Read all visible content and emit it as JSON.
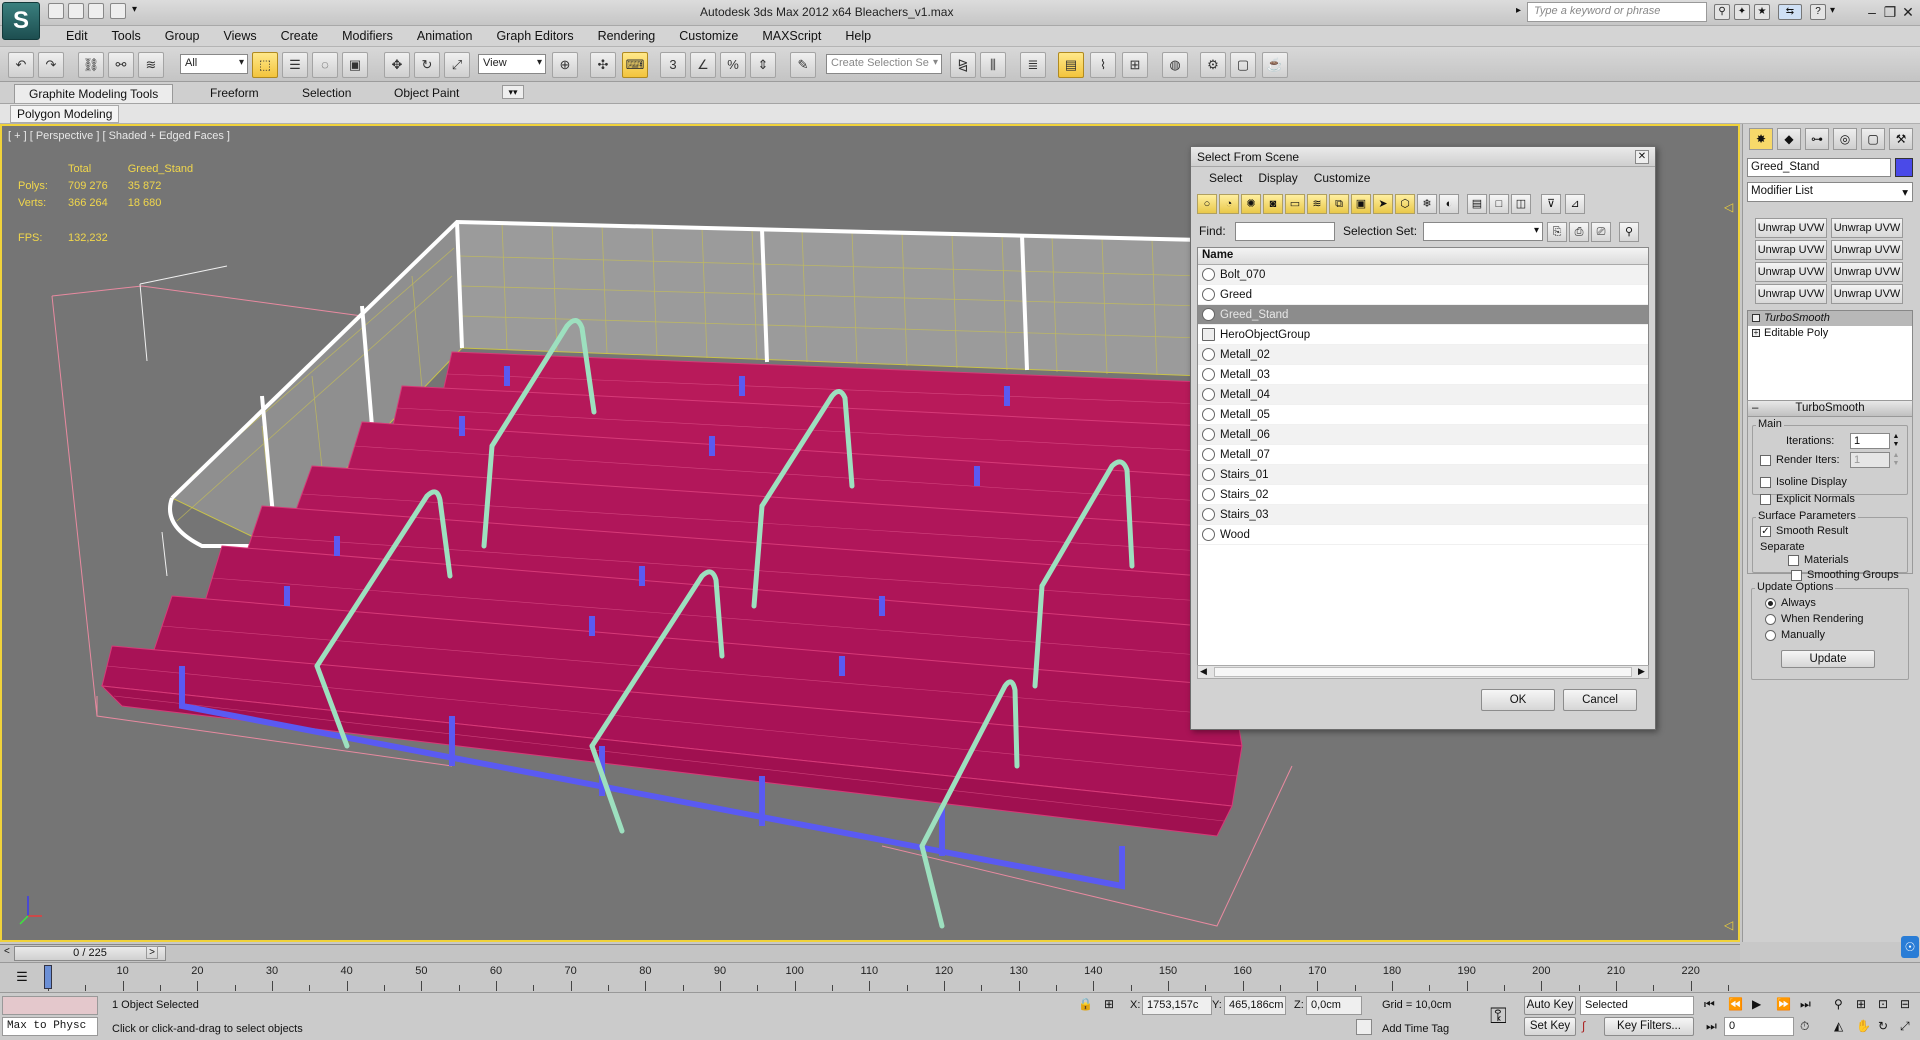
{
  "window": {
    "title": "Autodesk 3ds Max  2012 x64      Bleachers_v1.max",
    "search_placeholder": "Type a keyword or phrase"
  },
  "menu": [
    "Edit",
    "Tools",
    "Group",
    "Views",
    "Create",
    "Modifiers",
    "Animation",
    "Graph Editors",
    "Rendering",
    "Customize",
    "MAXScript",
    "Help"
  ],
  "toolbar": {
    "filter_value": "All",
    "refcoord_value": "View",
    "named_selection_placeholder": "Create Selection Se"
  },
  "ribbon": {
    "tabs": [
      "Graphite Modeling Tools",
      "Freeform",
      "Selection",
      "Object Paint"
    ],
    "subtab": "Polygon Modeling"
  },
  "viewport": {
    "label": "[ + ] [ Perspective ] [ Shaded + Edged Faces ]",
    "stats": {
      "col_total": "Total",
      "col_object": "Greed_Stand",
      "polys_label": "Polys:",
      "polys_total": "709 276",
      "polys_object": "35 872",
      "verts_label": "Verts:",
      "verts_total": "366 264",
      "verts_object": "18 680",
      "fps_label": "FPS:",
      "fps_value": "132,232"
    }
  },
  "dialog": {
    "title": "Select From Scene",
    "menu": [
      "Select",
      "Display",
      "Customize"
    ],
    "find_label": "Find:",
    "selection_set_label": "Selection Set:",
    "column_name": "Name",
    "items": [
      {
        "name": "Bolt_070",
        "selected": false,
        "group": false
      },
      {
        "name": "Greed",
        "selected": false,
        "group": false
      },
      {
        "name": "Greed_Stand",
        "selected": true,
        "group": false
      },
      {
        "name": "HeroObjectGroup",
        "selected": false,
        "group": true
      },
      {
        "name": "Metall_02",
        "selected": false,
        "group": false
      },
      {
        "name": "Metall_03",
        "selected": false,
        "group": false
      },
      {
        "name": "Metall_04",
        "selected": false,
        "group": false
      },
      {
        "name": "Metall_05",
        "selected": false,
        "group": false
      },
      {
        "name": "Metall_06",
        "selected": false,
        "group": false
      },
      {
        "name": "Metall_07",
        "selected": false,
        "group": false
      },
      {
        "name": "Stairs_01",
        "selected": false,
        "group": false
      },
      {
        "name": "Stairs_02",
        "selected": false,
        "group": false
      },
      {
        "name": "Stairs_03",
        "selected": false,
        "group": false
      },
      {
        "name": "Wood",
        "selected": false,
        "group": false
      }
    ],
    "ok_label": "OK",
    "cancel_label": "Cancel"
  },
  "command_panel": {
    "object_name": "Greed_Stand",
    "object_color": "#4a4ae8",
    "modifier_list": "Modifier List",
    "uvw_buttons": [
      "Unwrap UVW",
      "Unwrap UVW",
      "Unwrap UVW",
      "Unwrap UVW",
      "Unwrap UVW",
      "Unwrap UVW",
      "Unwrap UVW",
      "Unwrap UVW"
    ],
    "stack": [
      {
        "name": "TurboSmooth",
        "selected": true
      },
      {
        "name": "Editable Poly",
        "selected": false
      }
    ],
    "turbosmooth": {
      "title": "TurboSmooth",
      "main_label": "Main",
      "iterations_label": "Iterations:",
      "iterations_value": "1",
      "render_iters_label": "Render Iters:",
      "render_iters_value": "1",
      "isoline_label": "Isoline Display",
      "explicit_normals_label": "Explicit Normals",
      "surface_params_label": "Surface Parameters",
      "smooth_result_label": "Smooth Result",
      "separate_label": "Separate",
      "materials_label": "Materials",
      "smoothing_groups_label": "Smoothing Groups"
    },
    "update_options": {
      "title": "Update Options",
      "always_label": "Always",
      "when_rendering_label": "When Rendering",
      "manually_label": "Manually",
      "update_button": "Update"
    }
  },
  "timeline": {
    "frame_display": "0 / 225",
    "ticks": [
      10,
      20,
      30,
      40,
      50,
      60,
      70,
      80,
      90,
      100,
      110,
      120,
      130,
      140,
      150,
      160,
      170,
      180,
      190,
      200,
      210,
      220
    ]
  },
  "status": {
    "maxscript_label": "Max to Physc",
    "selection_info": "1 Object Selected",
    "prompt": "Click or click-and-drag to select objects",
    "x_label": "X:",
    "x_value": "1753,157c",
    "y_label": "Y:",
    "y_value": "465,186cm",
    "z_label": "Z:",
    "z_value": "0,0cm",
    "grid": "Grid = 10,0cm",
    "add_time_tag": "Add Time Tag",
    "auto_key": "Auto Key",
    "set_key": "Set Key",
    "selected_value": "Selected",
    "key_filters": "Key Filters...",
    "frame_value": "0"
  }
}
